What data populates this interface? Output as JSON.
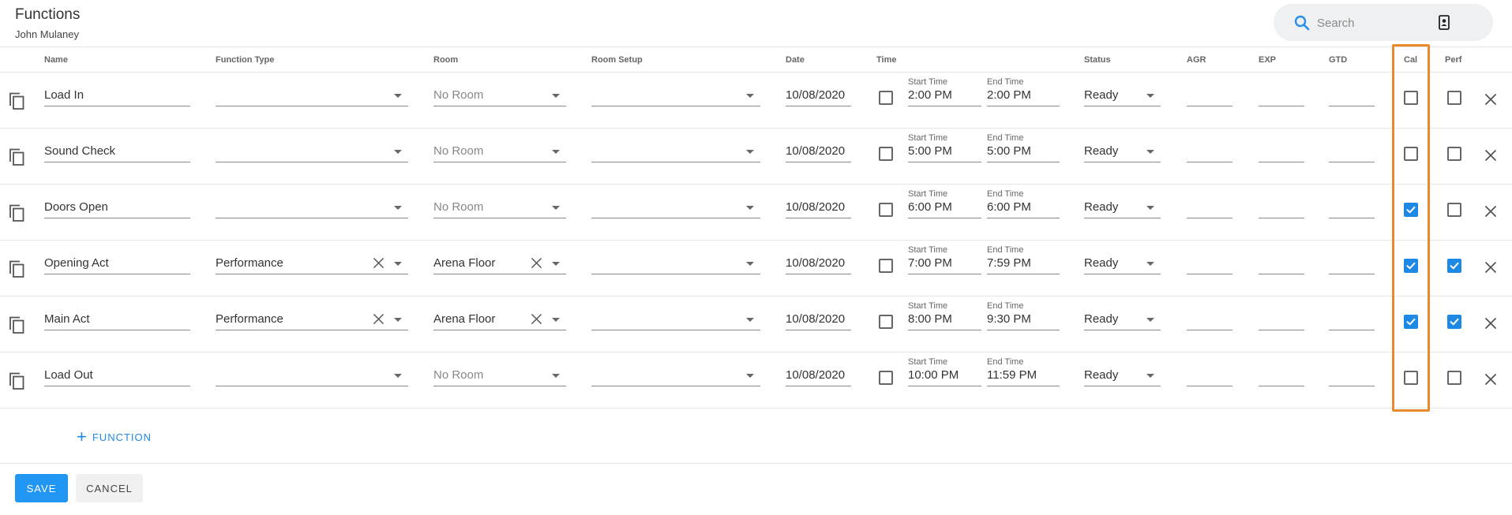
{
  "header": {
    "title": "Functions",
    "subtitle": "John Mulaney",
    "search_placeholder": "Search"
  },
  "columns": {
    "name": "Name",
    "function_type": "Function Type",
    "room": "Room",
    "room_setup": "Room Setup",
    "date": "Date",
    "time": "Time",
    "status": "Status",
    "agr": "AGR",
    "exp": "EXP",
    "gtd": "GTD",
    "cal": "Cal",
    "perf": "Perf"
  },
  "labels": {
    "start_time": "Start Time",
    "end_time": "End Time"
  },
  "rows": [
    {
      "name": "Load In",
      "function_type": "",
      "room": "No Room",
      "room_placeholder": true,
      "room_setup": "",
      "date": "10/08/2020",
      "all_day": false,
      "start": "2:00 PM",
      "end": "2:00 PM",
      "status": "Ready",
      "agr": "",
      "exp": "",
      "gtd": "",
      "cal": false,
      "perf": false
    },
    {
      "name": "Sound Check",
      "function_type": "",
      "room": "No Room",
      "room_placeholder": true,
      "room_setup": "",
      "date": "10/08/2020",
      "all_day": false,
      "start": "5:00 PM",
      "end": "5:00 PM",
      "status": "Ready",
      "agr": "",
      "exp": "",
      "gtd": "",
      "cal": false,
      "perf": false
    },
    {
      "name": "Doors Open",
      "function_type": "",
      "room": "No Room",
      "room_placeholder": true,
      "room_setup": "",
      "date": "10/08/2020",
      "all_day": false,
      "start": "6:00 PM",
      "end": "6:00 PM",
      "status": "Ready",
      "agr": "",
      "exp": "",
      "gtd": "",
      "cal": true,
      "perf": false
    },
    {
      "name": "Opening Act",
      "function_type": "Performance",
      "room": "Arena Floor",
      "room_placeholder": false,
      "room_setup": "",
      "date": "10/08/2020",
      "all_day": false,
      "start": "7:00 PM",
      "end": "7:59 PM",
      "status": "Ready",
      "agr": "",
      "exp": "",
      "gtd": "",
      "cal": true,
      "perf": true
    },
    {
      "name": "Main Act",
      "function_type": "Performance",
      "room": "Arena Floor",
      "room_placeholder": false,
      "room_setup": "",
      "date": "10/08/2020",
      "all_day": false,
      "start": "8:00 PM",
      "end": "9:30 PM",
      "status": "Ready",
      "agr": "",
      "exp": "",
      "gtd": "",
      "cal": true,
      "perf": true
    },
    {
      "name": "Load Out",
      "function_type": "",
      "room": "No Room",
      "room_placeholder": true,
      "room_setup": "",
      "date": "10/08/2020",
      "all_day": false,
      "start": "10:00 PM",
      "end": "11:59 PM",
      "status": "Ready",
      "agr": "",
      "exp": "",
      "gtd": "",
      "cal": false,
      "perf": false
    }
  ],
  "actions": {
    "add_function": "FUNCTION",
    "save": "SAVE",
    "cancel": "CANCEL"
  },
  "colors": {
    "accent": "#2196f3",
    "checkbox_on": "#1e88e5",
    "highlight": "#e88a2c"
  },
  "icons": [
    "search-icon",
    "contact-card-icon",
    "copy-icon",
    "dropdown-arrow-icon",
    "clear-icon",
    "close-icon",
    "plus-icon",
    "check-icon"
  ]
}
